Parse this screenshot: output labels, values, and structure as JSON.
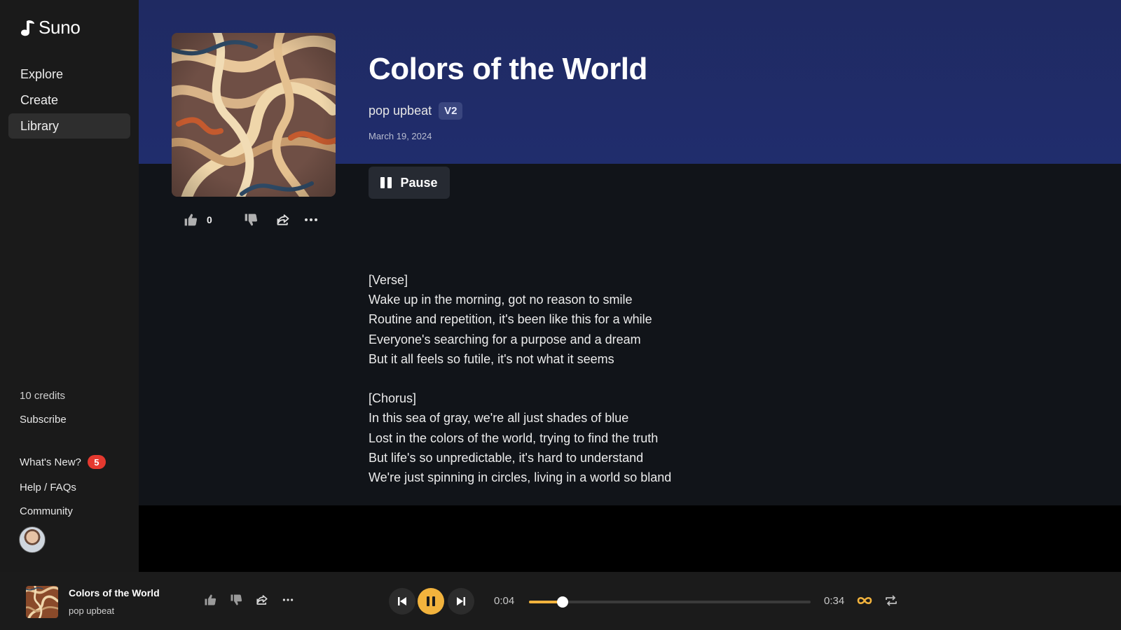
{
  "sidebar": {
    "brand": "Suno",
    "nav": [
      {
        "label": "Explore"
      },
      {
        "label": "Create"
      },
      {
        "label": "Library"
      }
    ],
    "credits": "10 credits",
    "subscribe": "Subscribe",
    "whats_new": "What's New?",
    "whats_new_badge": "5",
    "help": "Help / FAQs",
    "community": "Community"
  },
  "song": {
    "title": "Colors of the World",
    "genre": "pop upbeat",
    "version": "V2",
    "date": "March 19, 2024",
    "pause_label": "Pause",
    "like_count": "0",
    "lyrics": "[Verse]\nWake up in the morning, got no reason to smile\nRoutine and repetition, it's been like this for a while\nEveryone's searching for a purpose and a dream\nBut it all feels so futile, it's not what it seems\n\n[Chorus]\nIn this sea of gray, we're all just shades of blue\nLost in the colors of the world, trying to find the truth\nBut life's so unpredictable, it's hard to understand\nWe're just spinning in circles, living in a world so bland"
  },
  "player": {
    "title": "Colors of the World",
    "genre": "pop upbeat",
    "current_time": "0:04",
    "duration": "0:34",
    "progress": 0.12
  },
  "colors": {
    "accent": "#f2b33d",
    "banner": "#202d6d",
    "badge": "#e5392f"
  },
  "icons": [
    "music-note-icon",
    "thumbs-up-icon",
    "thumbs-down-icon",
    "share-icon",
    "more-icon",
    "pause-icon",
    "previous-icon",
    "next-icon",
    "infinity-loop-icon",
    "repeat-icon"
  ]
}
